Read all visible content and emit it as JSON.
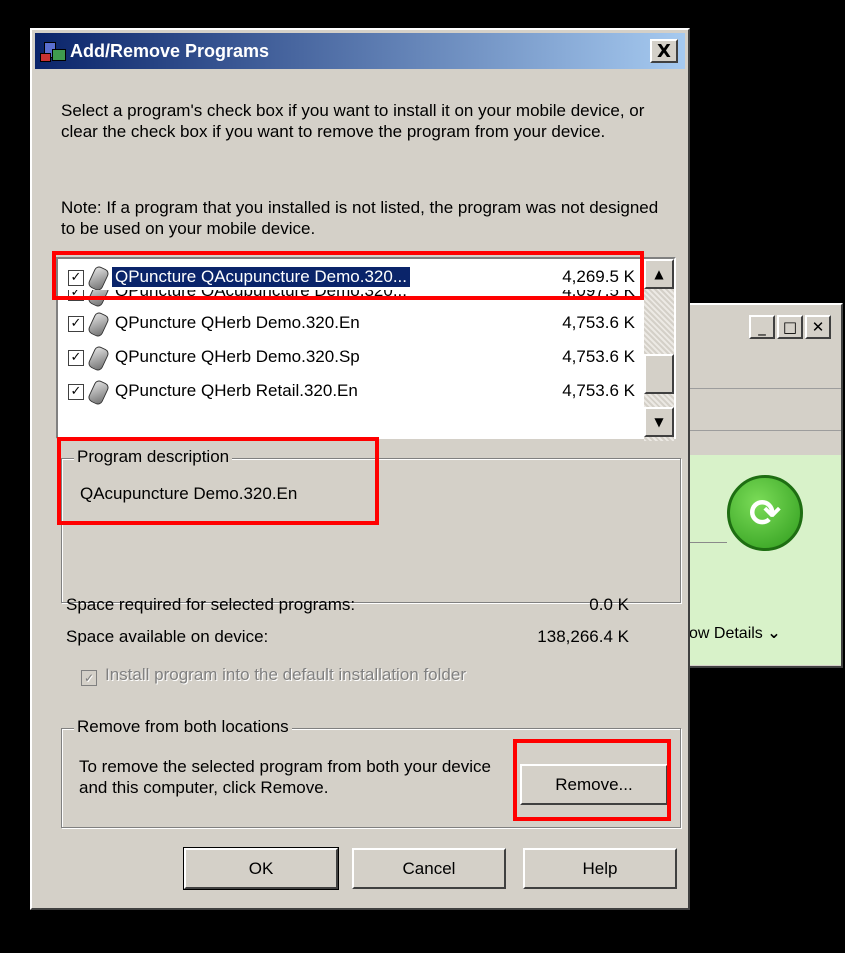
{
  "background_window": {
    "show_details_label": "ow Details",
    "show_details_icon": "double-chevron-down-icon",
    "sync_icon": "green-sync-arrows-icon"
  },
  "dialog": {
    "title": "Add/Remove Programs",
    "close_label": "X",
    "intro_text": "Select a program's check box if you want to install it on your mobile device, or clear the check box if you want to remove the program from your device.",
    "note_text": "Note:  If a program that you installed is not listed, the program was not designed to be used on your mobile device.",
    "programs": [
      {
        "name": "QPuncture QAcupuncture Demo.320...",
        "size": "4,269.5 K",
        "checked": true,
        "selected": true
      },
      {
        "name": "QPuncture QAcupuncture Demo.320...",
        "size": "4,097.5 K",
        "checked": true,
        "selected": false
      },
      {
        "name": "QPuncture QHerb Demo.320.En",
        "size": "4,753.6 K",
        "checked": true,
        "selected": false
      },
      {
        "name": "QPuncture QHerb Demo.320.Sp",
        "size": "4,753.6 K",
        "checked": true,
        "selected": false
      },
      {
        "name": "QPuncture QHerb Retail.320.En",
        "size": "4,753.6 K",
        "checked": true,
        "selected": false
      }
    ],
    "description_group": {
      "legend": "Program description",
      "text": "QAcupuncture Demo.320.En"
    },
    "space_required_label": "Space required for selected programs:",
    "space_required_value": "0.0 K",
    "space_available_label": "Space available on device:",
    "space_available_value": "138,266.4 K",
    "install_default_label": "Install program into the default installation folder",
    "install_default_checked": true,
    "remove_group": {
      "legend": "Remove from both locations",
      "text": "To remove the selected program from both your device and this computer, click Remove.",
      "button": "Remove..."
    },
    "buttons": {
      "ok": "OK",
      "cancel": "Cancel",
      "help": "Help"
    },
    "highlight_color": "#ff0000",
    "title_color": "#0a246a"
  }
}
